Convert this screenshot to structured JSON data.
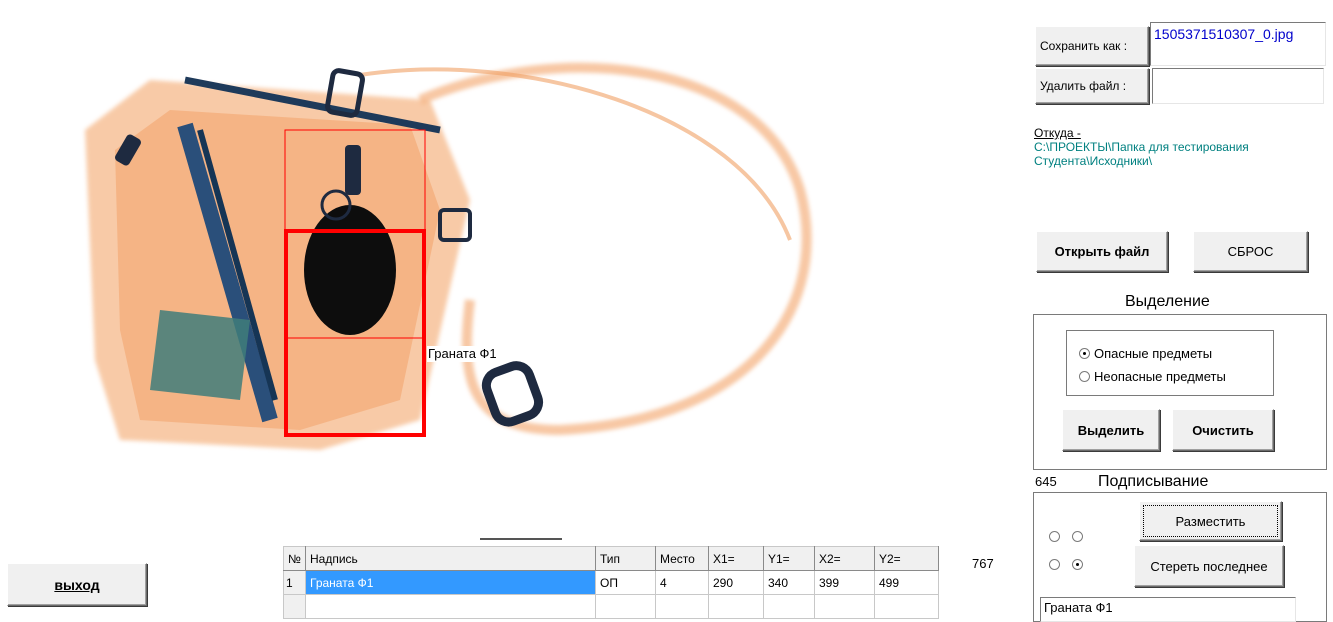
{
  "xray": {
    "detection_label": "Граната Ф1"
  },
  "exit_button": "выход",
  "table": {
    "headers": [
      "№",
      "Надпись",
      "Тип",
      "Место",
      "X1=",
      "Y1=",
      "X2=",
      "Y2="
    ],
    "rows": [
      {
        "n": "1",
        "label": "Граната Ф1",
        "type": "ОП",
        "place": "4",
        "x1": "290",
        "y1": "340",
        "x2": "399",
        "y2": "499"
      }
    ]
  },
  "value_767": "767",
  "value_645": "645",
  "save_as": {
    "label": "Сохранить как :",
    "filename": "1505371510307_0.jpg"
  },
  "delete_file": {
    "label": "Удалить файл :",
    "value": ""
  },
  "source": {
    "label": "Откуда -",
    "path": "C:\\ПРОЕКТЫ\\Папка для тестирования Студента\\Исходники\\"
  },
  "open_file_button": "Открыть файл",
  "reset_button": "СБРОС",
  "selection": {
    "title": "Выделение",
    "option_dangerous": "Опасные предметы",
    "option_safe": "Неопасные предметы",
    "select_button": "Выделить",
    "clear_button": "Очистить"
  },
  "signing": {
    "title": "Подписывание",
    "place_button": "Разместить",
    "erase_last_button": "Стереть последнее",
    "text_input": "Граната Ф1"
  },
  "colors": {
    "selection_box": "#ff0000",
    "grid_selected": "#3399ff",
    "path_text": "#008080",
    "filename_text": "#0000cc"
  }
}
